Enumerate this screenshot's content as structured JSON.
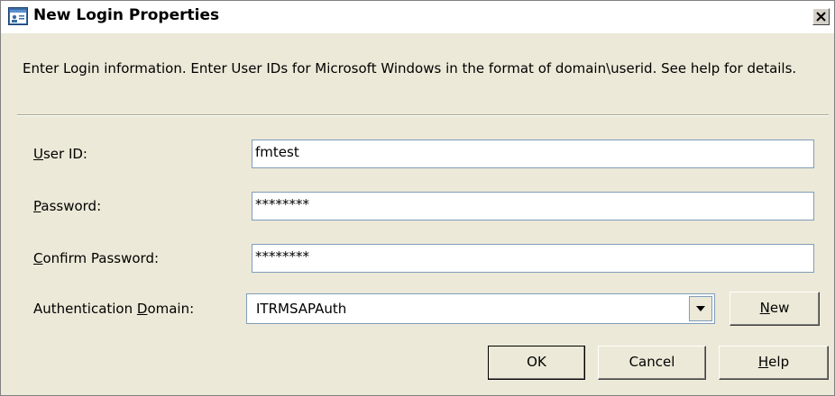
{
  "window": {
    "title": "New Login Properties",
    "icon": "app-window-icon",
    "close_icon": "close-icon"
  },
  "instructions": "Enter Login information. Enter User IDs for Microsoft Windows in the format of domain\\userid. See help for details.",
  "form": {
    "user_id": {
      "label_mnemonic": "U",
      "label_rest": "ser ID:",
      "value": "fmtest"
    },
    "password": {
      "label_mnemonic": "P",
      "label_rest": "assword:",
      "value": "********"
    },
    "confirm_password": {
      "label_mnemonic": "C",
      "label_rest": "onfirm Password:",
      "value": "********"
    },
    "auth_domain": {
      "label_pre": "Authentication ",
      "label_mnemonic": "D",
      "label_rest": "omain:",
      "value": "ITRMSAPAuth"
    }
  },
  "buttons": {
    "new": {
      "mnemonic": "N",
      "rest": "ew"
    },
    "ok": "OK",
    "cancel": "Cancel",
    "help": {
      "mnemonic": "H",
      "rest": "elp"
    }
  },
  "colors": {
    "dialog_bg": "#ece9d8",
    "field_border": "#7f9db9"
  }
}
